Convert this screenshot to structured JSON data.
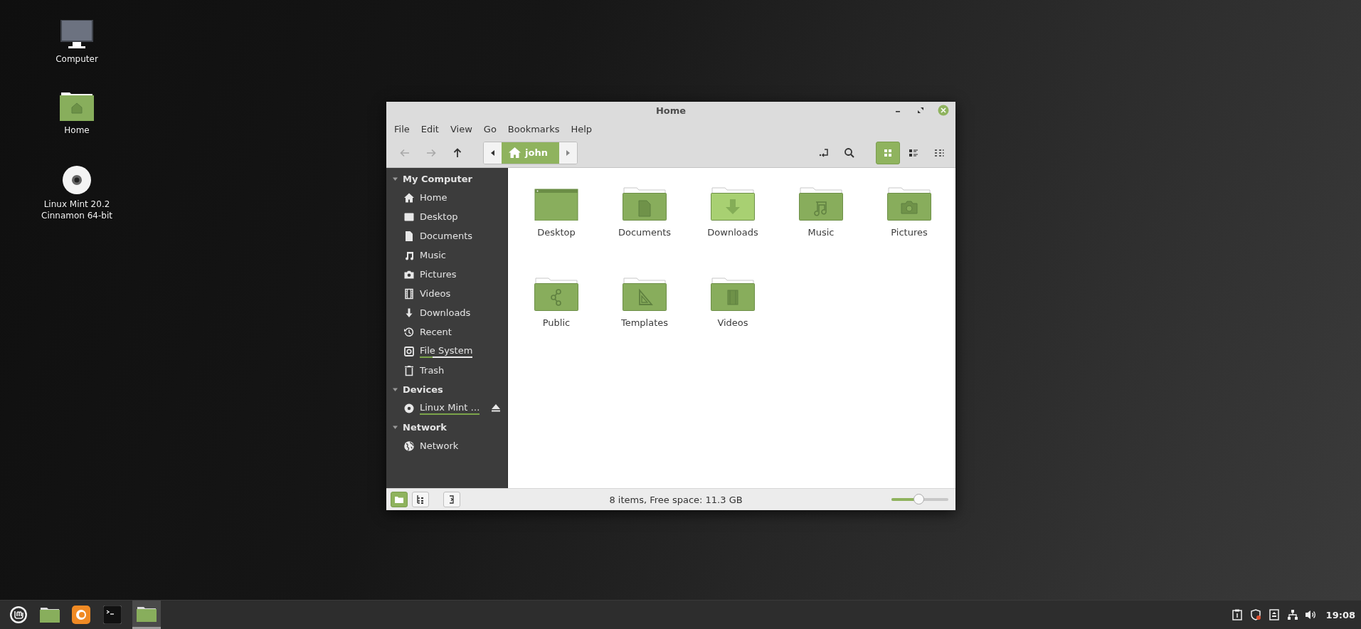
{
  "desktop_icons": [
    {
      "kind": "computer",
      "label": "Computer"
    },
    {
      "kind": "home",
      "label": "Home"
    },
    {
      "kind": "disc",
      "label": "Linux Mint 20.2 Cinnamon 64-bit"
    }
  ],
  "window": {
    "title": "Home",
    "menu": [
      "File",
      "Edit",
      "View",
      "Go",
      "Bookmarks",
      "Help"
    ],
    "nav_buttons": [
      {
        "kind": "back",
        "disabled": true
      },
      {
        "kind": "forward",
        "disabled": true
      },
      {
        "kind": "up",
        "disabled": false
      }
    ],
    "path": [
      "john"
    ],
    "view_buttons": [
      {
        "kind": "icons",
        "selected": true
      },
      {
        "kind": "list",
        "selected": false
      },
      {
        "kind": "compact",
        "selected": false
      }
    ],
    "sidebar": [
      {
        "title": "My Computer",
        "expanded": true,
        "items": [
          {
            "kind": "home",
            "label": "Home"
          },
          {
            "kind": "desktop",
            "label": "Desktop"
          },
          {
            "kind": "documents",
            "label": "Documents"
          },
          {
            "kind": "music",
            "label": "Music"
          },
          {
            "kind": "pictures",
            "label": "Pictures"
          },
          {
            "kind": "videos",
            "label": "Videos"
          },
          {
            "kind": "downloads",
            "label": "Downloads"
          },
          {
            "kind": "recent",
            "label": "Recent"
          },
          {
            "kind": "filesystem",
            "label": "File System",
            "level": 0.24
          },
          {
            "kind": "trash",
            "label": "Trash"
          }
        ]
      },
      {
        "title": "Devices",
        "expanded": true,
        "items": [
          {
            "kind": "disc",
            "label": "Linux Mint …",
            "level": 1,
            "ejectable": true
          }
        ]
      },
      {
        "title": "Network",
        "expanded": true,
        "items": [
          {
            "kind": "network",
            "label": "Network"
          }
        ]
      }
    ],
    "files": [
      {
        "kind": "desktop",
        "name": "Desktop"
      },
      {
        "kind": "documents",
        "name": "Documents"
      },
      {
        "kind": "downloads",
        "name": "Downloads"
      },
      {
        "kind": "music",
        "name": "Music"
      },
      {
        "kind": "pictures",
        "name": "Pictures"
      },
      {
        "kind": "public",
        "name": "Public"
      },
      {
        "kind": "templates",
        "name": "Templates"
      },
      {
        "kind": "videos",
        "name": "Videos"
      }
    ],
    "status_buttons": [
      {
        "kind": "places",
        "selected": true
      },
      {
        "kind": "tree",
        "selected": false
      },
      {
        "kind": "extra-pane",
        "selected": false
      }
    ],
    "status_text": "8 items, Free space: 11.3 GB",
    "zoom_slider": {
      "level": 0.49
    }
  },
  "taskbar": {
    "window_button": {
      "active": true
    },
    "clock": "19:08"
  }
}
